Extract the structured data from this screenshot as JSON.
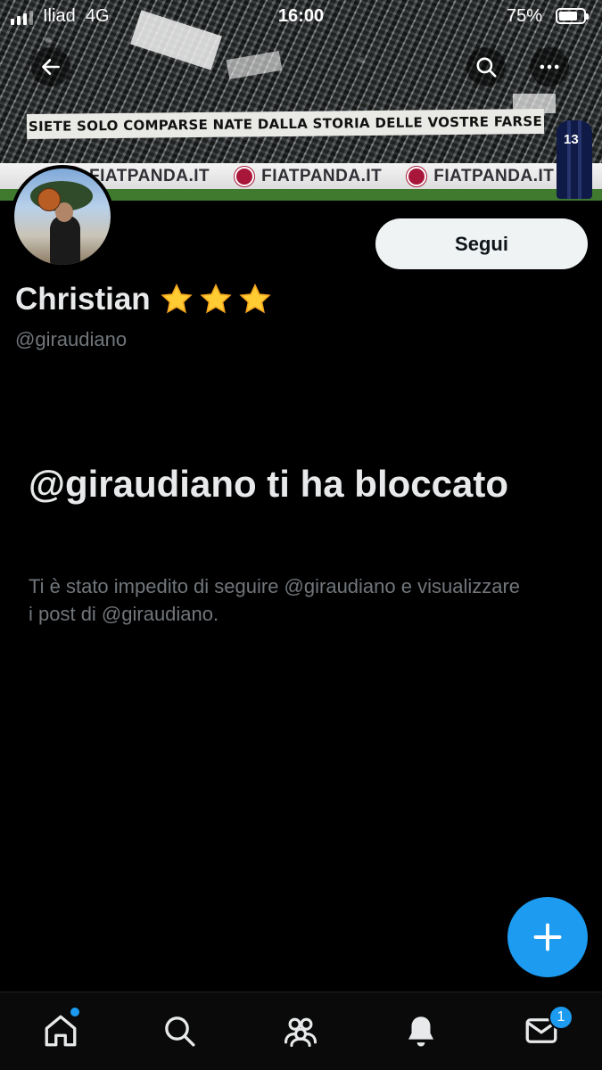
{
  "status_bar": {
    "carrier": "Iliad",
    "network": "4G",
    "time": "16:00",
    "battery_percent": "75%",
    "battery_level": 0.75
  },
  "banner": {
    "banner_text": "SIETE SOLO COMPARSE NATE DALLA STORIA DELLE VOSTRE FARSE",
    "ad_text": "FIATPANDA.IT",
    "player_number": "13"
  },
  "profile": {
    "follow_label": "Segui",
    "display_name": "Christian",
    "emoji_stars": 3,
    "handle": "@giraudiano"
  },
  "blocked": {
    "title": "@giraudiano ti ha bloccato",
    "description": "Ti è stato impedito di seguire @giraudiano e visualizzare i post di @giraudiano."
  },
  "tabbar": {
    "items": [
      "home-icon",
      "search-icon",
      "communities-icon",
      "notifications-icon",
      "messages-icon"
    ],
    "messages_badge": "1"
  },
  "colors": {
    "accent": "#1d9bf0",
    "background": "#000000",
    "secondary_text": "#71767b"
  }
}
